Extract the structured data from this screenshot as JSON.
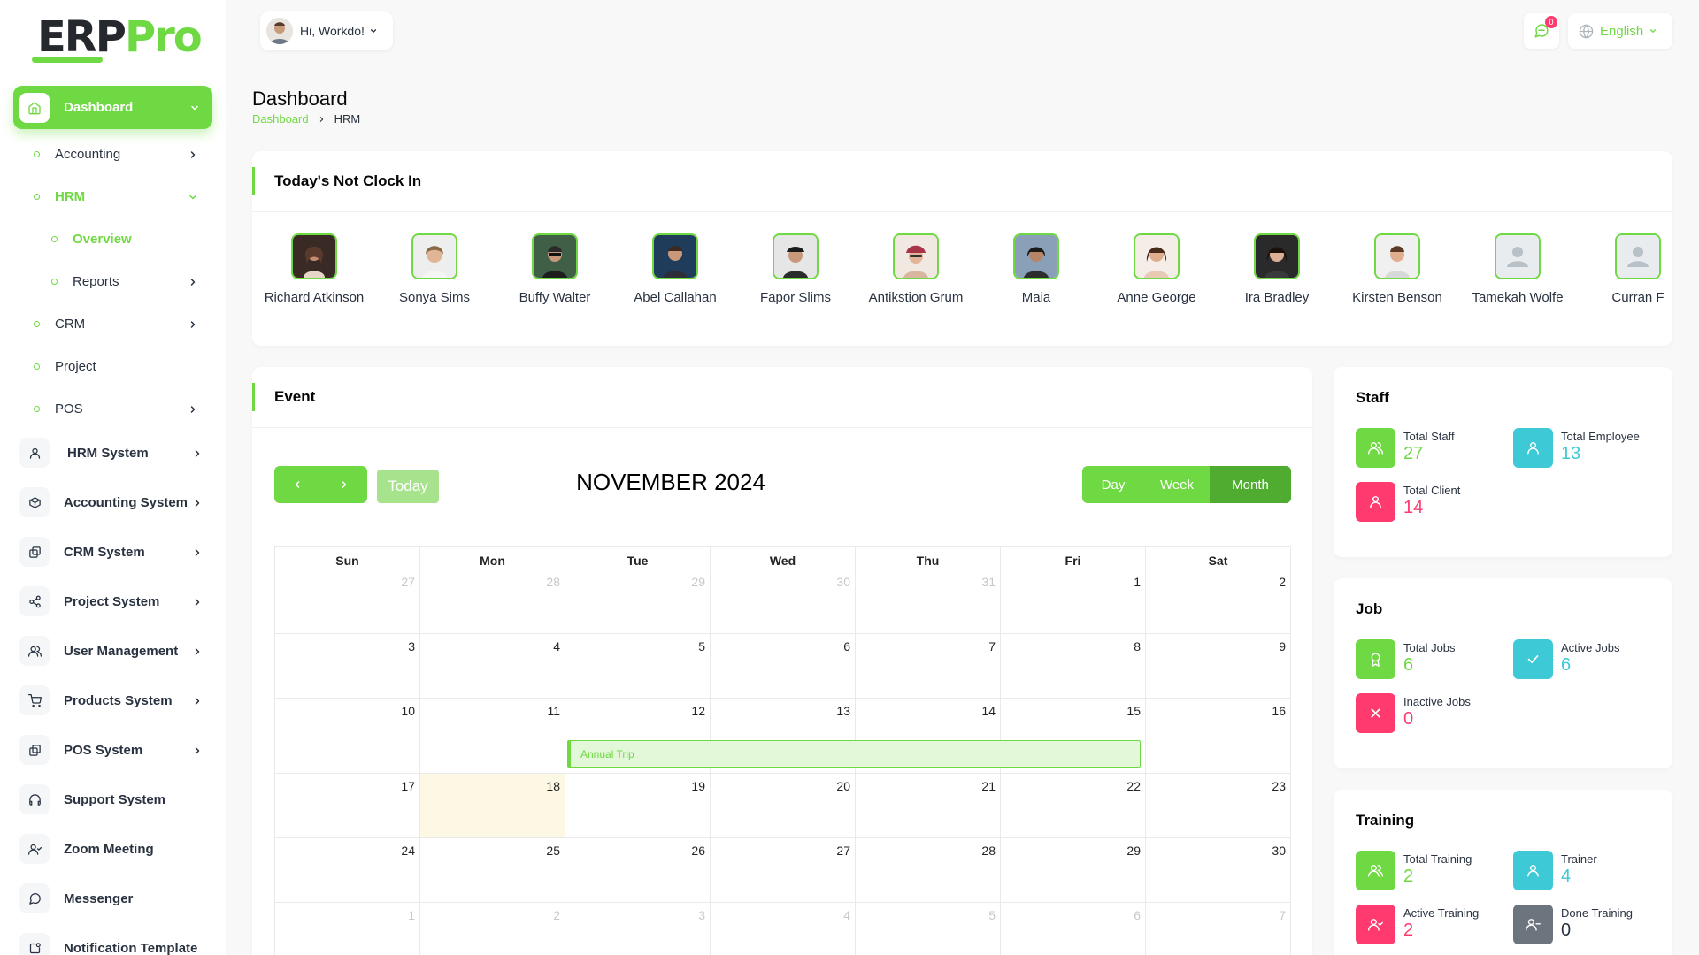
{
  "brand": {
    "part1": "ERP",
    "part2": "Pro"
  },
  "sidebar": {
    "active": {
      "label": "Dashboard"
    },
    "subs": [
      {
        "label": "Accounting"
      },
      {
        "label": "HRM"
      },
      {
        "label": "Overview"
      },
      {
        "label": "Reports"
      },
      {
        "label": "CRM"
      },
      {
        "label": "Project"
      },
      {
        "label": "POS"
      }
    ],
    "items": [
      {
        "label": "HRM System",
        "icon": "user-icon"
      },
      {
        "label": "Accounting System",
        "icon": "box-icon"
      },
      {
        "label": "CRM System",
        "icon": "layers-icon"
      },
      {
        "label": "Project System",
        "icon": "share-icon"
      },
      {
        "label": "User Management",
        "icon": "users-icon"
      },
      {
        "label": "Products System",
        "icon": "cart-icon"
      },
      {
        "label": "POS System",
        "icon": "layers-icon"
      },
      {
        "label": "Support System",
        "icon": "headphones-icon"
      },
      {
        "label": "Zoom Meeting",
        "icon": "user-check-icon"
      },
      {
        "label": "Messenger",
        "icon": "message-icon"
      },
      {
        "label": "Notification Template",
        "icon": "notification-icon"
      }
    ]
  },
  "header": {
    "greeting": "Hi, Workdo!",
    "notification_count": "0",
    "language": "English"
  },
  "page": {
    "title": "Dashboard",
    "breadcrumb": [
      "Dashboard",
      "HRM"
    ]
  },
  "clock_in": {
    "title": "Today's Not Clock In",
    "employees": [
      {
        "name": "Richard Atkinson"
      },
      {
        "name": "Sonya Sims"
      },
      {
        "name": "Buffy Walter"
      },
      {
        "name": "Abel Callahan"
      },
      {
        "name": "Fapor Slims"
      },
      {
        "name": "Antikstion Grum"
      },
      {
        "name": "Maia"
      },
      {
        "name": "Anne George"
      },
      {
        "name": "Ira Bradley"
      },
      {
        "name": "Kirsten Benson"
      },
      {
        "name": "Tamekah Wolfe"
      },
      {
        "name": "Curran F"
      }
    ]
  },
  "event": {
    "title": "Event",
    "today_label": "Today",
    "month_title": "NOVEMBER 2024",
    "views": [
      "Day",
      "Week",
      "Month"
    ],
    "active_view": "Month",
    "weekdays": [
      "Sun",
      "Mon",
      "Tue",
      "Wed",
      "Thu",
      "Fri",
      "Sat"
    ],
    "weeks": [
      [
        "27",
        "28",
        "29",
        "30",
        "31",
        "1",
        "2"
      ],
      [
        "3",
        "4",
        "5",
        "6",
        "7",
        "8",
        "9"
      ],
      [
        "10",
        "11",
        "12",
        "13",
        "14",
        "15",
        "16"
      ],
      [
        "17",
        "18",
        "19",
        "20",
        "21",
        "22",
        "23"
      ],
      [
        "24",
        "25",
        "26",
        "27",
        "28",
        "29",
        "30"
      ],
      [
        "1",
        "2",
        "3",
        "4",
        "5",
        "6",
        "7"
      ]
    ],
    "events": [
      {
        "label": "Annual Trip",
        "start": "2024-11-12",
        "end": "2024-11-15"
      }
    ],
    "today_date": "2024-11-18"
  },
  "staff": {
    "title": "Staff",
    "stats": [
      {
        "label": "Total Staff",
        "value": "27",
        "color": "#6fd943",
        "icon": "users-icon"
      },
      {
        "label": "Total Employee",
        "value": "13",
        "color": "#3ec9d6",
        "icon": "user-icon"
      },
      {
        "label": "Total Client",
        "value": "14",
        "color": "#ff3a6e",
        "icon": "user-icon"
      }
    ]
  },
  "job": {
    "title": "Job",
    "stats": [
      {
        "label": "Total Jobs",
        "value": "6",
        "color": "#6fd943",
        "icon": "award-icon"
      },
      {
        "label": "Active Jobs",
        "value": "6",
        "color": "#3ec9d6",
        "icon": "check-icon"
      },
      {
        "label": "Inactive Jobs",
        "value": "0",
        "color": "#ff3a6e",
        "icon": "close-icon"
      }
    ]
  },
  "training": {
    "title": "Training",
    "stats": [
      {
        "label": "Total Training",
        "value": "2",
        "color": "#6fd943",
        "icon": "users-icon"
      },
      {
        "label": "Trainer",
        "value": "4",
        "color": "#3ec9d6",
        "icon": "user-icon"
      },
      {
        "label": "Active Training",
        "value": "2",
        "color": "#ff3a6e",
        "icon": "user-check-icon"
      },
      {
        "label": "Done Training",
        "value": "0",
        "color": "#6c757d",
        "icon": "user-minus-icon"
      }
    ]
  }
}
